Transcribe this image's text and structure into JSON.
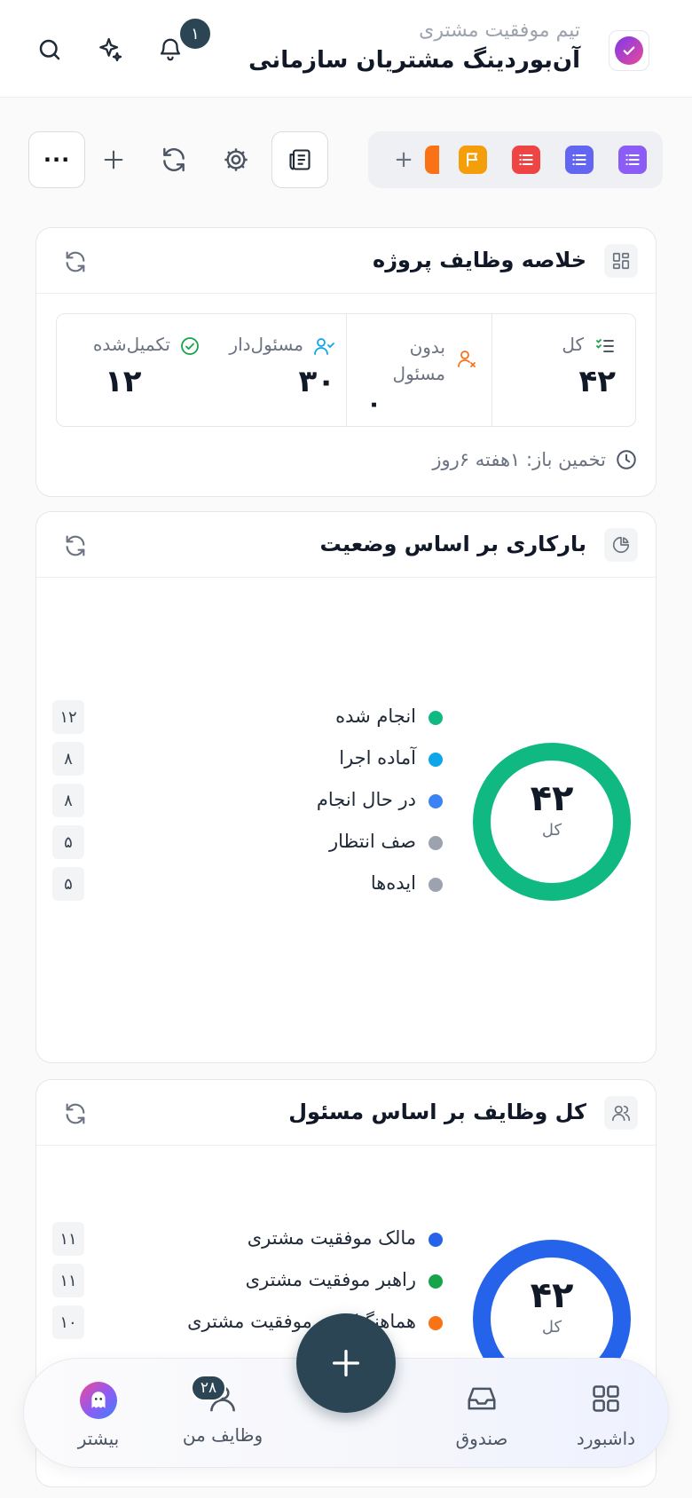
{
  "header": {
    "subtitle": "تیم موفقیت مشتری",
    "title": "آن‌بوردینگ مشتریان سازمانی",
    "notification_count": "۱"
  },
  "toolbar": {
    "add_view": "+",
    "more": "···"
  },
  "summary": {
    "title": "خلاصه وظایف پروژه",
    "total_label": "کل",
    "total_value": "۴۲",
    "unassigned_label": "بدون مسئول",
    "unassigned_value": "۰",
    "assigned_label": "مسئول‌دار",
    "assigned_value": "۳۰",
    "completed_label": "تکمیل‌شده",
    "completed_value": "۱۲",
    "estimate": "تخمین باز: ۱هفته ۶روز"
  },
  "status_workload": {
    "title": "بارکاری بر اساس وضعیت",
    "total": "۴۲",
    "total_label": "کل",
    "items": [
      {
        "name": "انجام شده",
        "count": "۱۲",
        "color": "#10b981"
      },
      {
        "name": "آماده اجرا",
        "count": "۸",
        "color": "#0ea5e9"
      },
      {
        "name": "در حال انجام",
        "count": "۸",
        "color": "#3b82f6"
      },
      {
        "name": "صف انتظار",
        "count": "۵",
        "color": "#9ca3af"
      },
      {
        "name": "ایده‌ها",
        "count": "۵",
        "color": "#9ca3af"
      }
    ]
  },
  "assignee_workload": {
    "title": "کل وظایف بر اساس مسئول",
    "total": "۴۲",
    "total_label": "کل",
    "items": [
      {
        "name": "مالک موفقیت مشتری",
        "count": "۱۱",
        "color": "#2563eb"
      },
      {
        "name": "راهبر موفقیت مشتری",
        "count": "۱۱",
        "color": "#16a34a"
      },
      {
        "name": "هماهنگ‌کننده موفقیت مشتری",
        "count": "۱۰",
        "color": "#f97316"
      }
    ]
  },
  "bottom_nav": {
    "dashboard": "داشبورد",
    "inbox": "صندوق",
    "my_tasks": "وظایف من",
    "my_tasks_count": "۲۸",
    "more": "بیشتر",
    "fab": "+"
  }
}
